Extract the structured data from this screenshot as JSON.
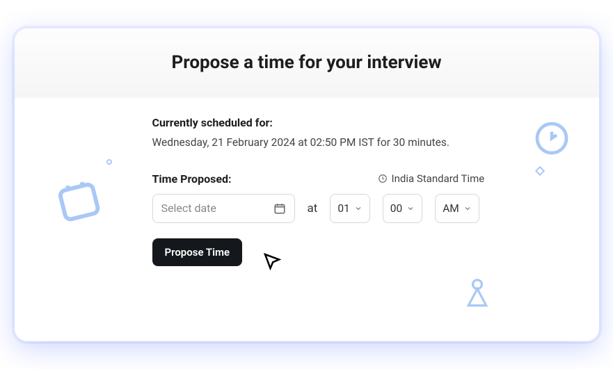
{
  "hero": {
    "title": "Propose a time for your interview"
  },
  "scheduled": {
    "label": "Currently scheduled for:",
    "text": "Wednesday, 21 February 2024 at 02:50 PM IST for 30 minutes."
  },
  "proposed": {
    "label": "Time Proposed:",
    "timezone": "India Standard Time",
    "date_placeholder": "Select date",
    "at_label": "at",
    "hour": "01",
    "minute": "00",
    "ampm": "AM"
  },
  "actions": {
    "propose": "Propose Time"
  }
}
